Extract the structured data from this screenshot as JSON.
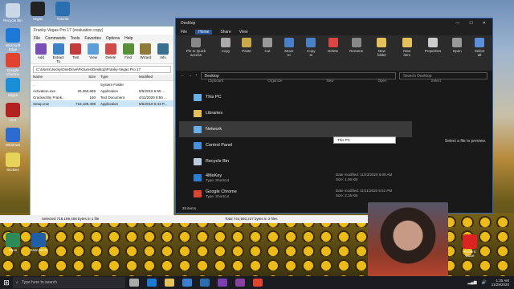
{
  "desktop": {
    "icons_left": [
      {
        "label": "Recycle Bin",
        "color": "#c9d7e6"
      },
      {
        "label": "Microsoft Edge",
        "color": "#1c7ad6"
      },
      {
        "label": "Google Chrome",
        "color": "#e0442f"
      },
      {
        "label": "Skype",
        "color": "#1a8fd8"
      },
      {
        "label": "ICH",
        "color": "#b32121"
      },
      {
        "label": "Windows",
        "color": "#2c6bd1"
      },
      {
        "label": "Stickies",
        "color": "#e8d35a"
      }
    ],
    "icons_top": [
      {
        "label": "Vegas",
        "color": "#222222"
      },
      {
        "label": "Tutorial",
        "color": "#2a6fb0"
      }
    ],
    "icons_bottom": [
      {
        "label": "Save",
        "color": "#2e8b57"
      },
      {
        "label": "Save MAX",
        "color": "#1f5fa8"
      }
    ],
    "right_icon": {
      "label": "Rubik's Cube",
      "color": "#d22"
    }
  },
  "winrar": {
    "title": "Franky-Vegas Pro 17 (evaluation copy)",
    "menu": [
      "File",
      "Commands",
      "Tools",
      "Favorites",
      "Options",
      "Help"
    ],
    "tools": [
      {
        "label": "Add",
        "color": "#7a4fb5"
      },
      {
        "label": "Extract To",
        "color": "#3b82c4"
      },
      {
        "label": "Test",
        "color": "#c43b3b"
      },
      {
        "label": "View",
        "color": "#5c9fd8"
      },
      {
        "label": "Delete",
        "color": "#d04a4a"
      },
      {
        "label": "Find",
        "color": "#5a8f3a"
      },
      {
        "label": "Wizard",
        "color": "#8f7a3a"
      },
      {
        "label": "Info",
        "color": "#3a6f8f"
      }
    ],
    "path": "C:\\Users\\Jvicky\\OneDrive\\Pictures\\Desktop\\Franky-Vegas Pro 17",
    "columns": [
      "Name",
      "Size",
      "Type",
      "Modified"
    ],
    "rows": [
      {
        "name": "..",
        "size": "",
        "type": "System Folder",
        "modified": "",
        "selected": false
      },
      {
        "name": "Activation.exe",
        "size": "26,360,659",
        "type": "Application",
        "modified": "8/5/2019 6:55 ...",
        "selected": false
      },
      {
        "name": "Cracked By Frank...",
        "size": "160",
        "type": "Text Document",
        "modified": "4/11/2020 8:50 ...",
        "selected": false
      },
      {
        "name": "Setup.exe",
        "size": "718,189,408",
        "type": "Application",
        "modified": "8/5/2019 5:43 P...",
        "selected": true
      }
    ]
  },
  "statusbar": {
    "left": "Selected 718,189,408 bytes in 1 file",
    "right": "Total 744,550,227 bytes in 3 files"
  },
  "explorer": {
    "title": "Desktop",
    "window_controls": [
      "—",
      "☐",
      "✕"
    ],
    "tabs": [
      "File",
      "Home",
      "Share",
      "View"
    ],
    "active_tab": "Home",
    "ribbon": [
      {
        "label": "Pin to Quick access",
        "color": "#888888"
      },
      {
        "label": "Copy",
        "color": "#aaaaaa"
      },
      {
        "label": "Paste",
        "color": "#c9a94a"
      },
      {
        "label": "Cut",
        "color": "#999999"
      },
      {
        "label": "Move to",
        "color": "#4a7fc9"
      },
      {
        "label": "Copy to",
        "color": "#4a7fc9"
      },
      {
        "label": "Delete",
        "color": "#d44"
      },
      {
        "label": "Rename",
        "color": "#888888"
      },
      {
        "label": "New folder",
        "color": "#e5c15a"
      },
      {
        "label": "New item",
        "color": "#e5c15a"
      },
      {
        "label": "Properties",
        "color": "#cccccc"
      },
      {
        "label": "Open",
        "color": "#999999"
      },
      {
        "label": "Select all",
        "color": "#5a8fd9"
      }
    ],
    "ribbon_groups": [
      "Clipboard",
      "Organize",
      "New",
      "Open",
      "Select"
    ],
    "address": "Desktop",
    "search_placeholder": "Search Desktop",
    "items": [
      {
        "name": "This PC",
        "color": "#6ab0e8",
        "hi": false
      },
      {
        "name": "Libraries",
        "color": "#e5c15a",
        "hi": false
      },
      {
        "name": "Network",
        "color": "#6ab0e8",
        "hi": true
      },
      {
        "name": "Control Panel",
        "color": "#4a8fd9",
        "hi": false
      },
      {
        "name": "Recycle Bin",
        "color": "#bcd",
        "hi": false
      },
      {
        "name": "4MeKey",
        "sub": "Type: Shortcut",
        "color": "#2a7fd4",
        "hi": false,
        "meta": "Date modified: 11/23/2020 6:08 AM",
        "size": "Size: 1.06 KB"
      },
      {
        "name": "Google Chrome",
        "sub": "Type: Shortcut",
        "color": "#e0442f",
        "hi": false,
        "meta": "Date modified: 11/11/2020 5:51 PM",
        "size": "Size: 2.15 KB"
      }
    ],
    "tooltip": "This PC",
    "preview_text": "Select a file to preview.",
    "status": "29 items"
  },
  "taskbar": {
    "start": "⊞",
    "search_placeholder": "Type here to search",
    "apps": [
      {
        "name": "task-view",
        "color": "#aaaaaa"
      },
      {
        "name": "edge",
        "color": "#1c7ad6"
      },
      {
        "name": "file-explorer",
        "color": "#e5c15a"
      },
      {
        "name": "store",
        "color": "#3a7fd4"
      },
      {
        "name": "mail",
        "color": "#2a6fb0"
      },
      {
        "name": "obs",
        "color": "#7a3fb5"
      },
      {
        "name": "winrar",
        "color": "#8a3fa5"
      },
      {
        "name": "chrome",
        "color": "#e0442f"
      }
    ],
    "time": "1:35 AM",
    "date": "11/29/2020"
  }
}
